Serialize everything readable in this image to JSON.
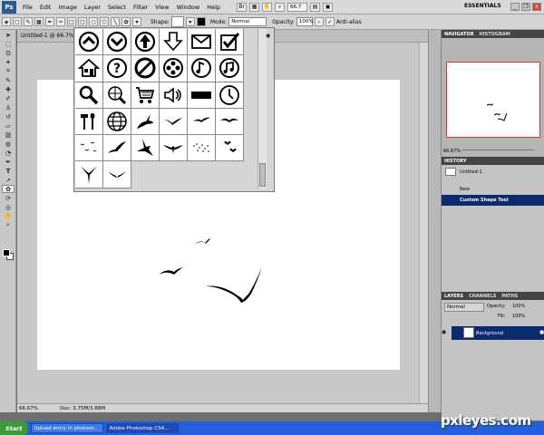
{
  "app": {
    "logo": "Ps",
    "workspace": "ESSENTIALS",
    "zoom": "66.7"
  },
  "menu": [
    "File",
    "Edit",
    "Image",
    "Layer",
    "Select",
    "Filter",
    "View",
    "Window",
    "Help"
  ],
  "options": {
    "shape_label": "Shape:",
    "mode_label": "Mode:",
    "mode_value": "Normal",
    "opacity_label": "Opacity:",
    "opacity_value": "100%",
    "antialias_label": "Anti-alias"
  },
  "document": {
    "tab_title": "Untitled-1 @ 66.7% (",
    "status_zoom": "66.67%",
    "status_doc": "Doc: 3.75M/3.88M"
  },
  "navigator": {
    "tabs": [
      "NAVIGATOR",
      "HISTOGRAM"
    ],
    "zoom": "66.67%"
  },
  "history": {
    "title": "HISTORY",
    "snapshot": "Untitled-1",
    "items": [
      "New",
      "Custom Shape Tool"
    ]
  },
  "layers": {
    "tabs": [
      "LAYERS",
      "CHANNELS",
      "PATHS"
    ],
    "blend": "Normal",
    "opacity_label": "Opacity:",
    "opacity": "100%",
    "fill_label": "Fill:",
    "fill": "100%",
    "layer_name": "Background"
  },
  "taskbar": {
    "start": "Start",
    "tasks": [
      "Upload entry in photosh...",
      "Adobe Photoshop CS4..."
    ]
  },
  "watermark": "pxleyes.com",
  "shapes": [
    "circle-chevron-up-icon",
    "circle-chevron-down-icon",
    "circle-arrow-up-icon",
    "arrow-down-outline-icon",
    "envelope-icon",
    "checkbox-icon",
    "house-icon",
    "question-icon",
    "no-symbol-icon",
    "film-reel-icon",
    "music-note-icon",
    "music-notes-icon",
    "magnifier-icon",
    "globe-search-icon",
    "shopping-cart-icon",
    "speaker-icon",
    "battery-bar-icon",
    "clock-icon",
    "tools-icon",
    "globe-icon",
    "bird-icon",
    "bird-flying-icon",
    "bird-flying-icon",
    "bird-flying-icon",
    "birds-flock-icon",
    "bird-flying-icon",
    "bird-silhouette-icon",
    "bird-eagle-icon",
    "dots-flock-icon",
    "birds-flock-icon",
    "bird-wings-up-icon",
    "bird-flying-icon"
  ]
}
